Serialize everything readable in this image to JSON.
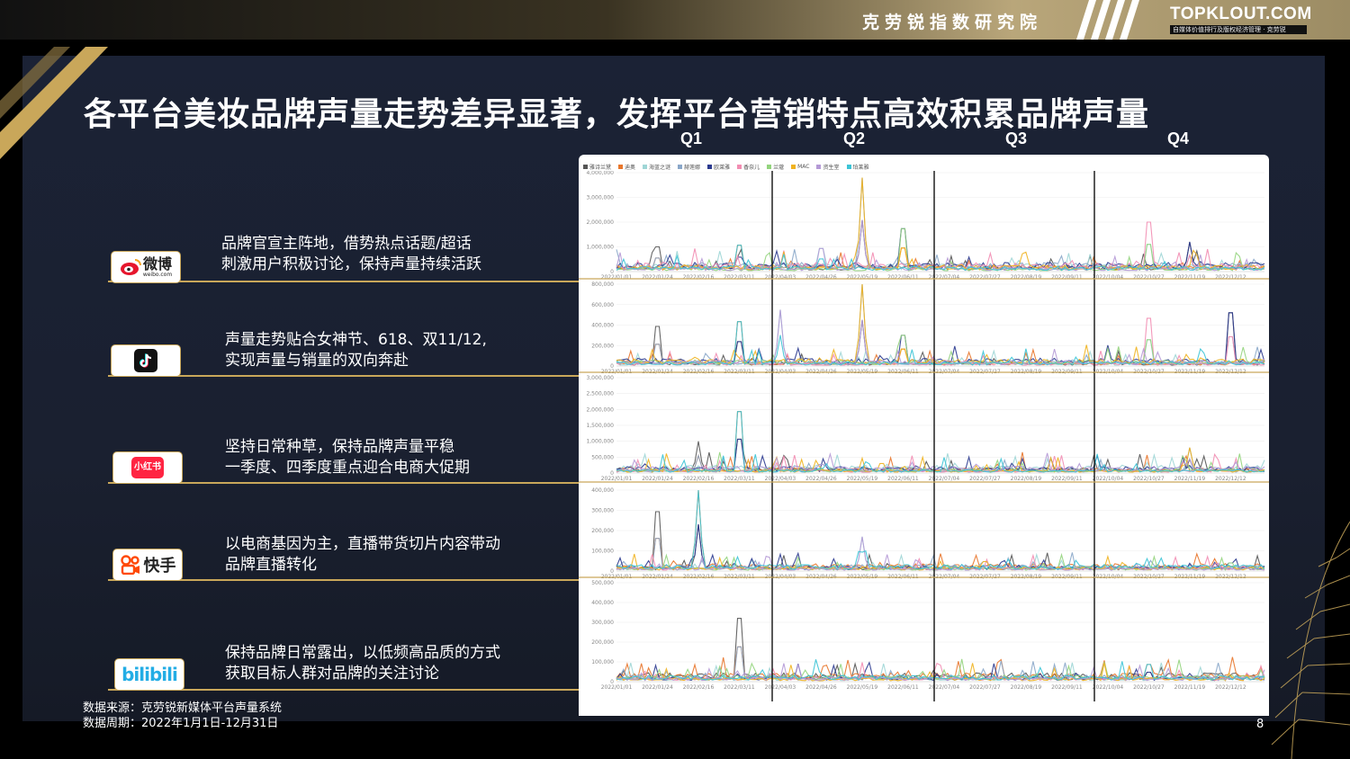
{
  "header": {
    "org_name": "克劳锐指数研究院",
    "logo_main": "TOPKLOUT.COM",
    "logo_sub": "自媒体价值排行及版权经济管理 · 克劳锐"
  },
  "title": "各平台美妆品牌声量走势差异显著，发挥平台营销特点高效积累品牌声量",
  "quarters": [
    "Q1",
    "Q2",
    "Q3",
    "Q4"
  ],
  "legend": [
    "雅诗兰黛",
    "迪奥",
    "海蓝之谜",
    "赫莲娜",
    "欧莱雅",
    "香奈儿",
    "兰蔻",
    "MAC",
    "资生堂",
    "珀莱雅"
  ],
  "colors": {
    "series": [
      "#555555",
      "#e8762b",
      "#9fd6d6",
      "#8aa7c9",
      "#2b3a8f",
      "#f28db2",
      "#93d47d",
      "#f0b21f",
      "#b59ad6",
      "#3cc4d6"
    ],
    "gold": "#c9a75a",
    "panel": "#1b2235"
  },
  "platforms": [
    {
      "name": "微博",
      "logo_text": "微博",
      "logo_sub": "weibo.com",
      "icon": "weibo-icon",
      "desc_line1": "品牌官宣主阵地，借势热点话题/超话",
      "desc_line2": "刺激用户积极讨论，保持声量持续活跃"
    },
    {
      "name": "抖音",
      "icon": "douyin-icon",
      "desc_line1": "声量走势贴合女神节、618、双11/12,",
      "desc_line2": "实现声量与销量的双向奔赴"
    },
    {
      "name": "小红书",
      "logo_text": "小红书",
      "icon": "xiaohongshu-icon",
      "desc_line1": "坚持日常种草，保持品牌声量平稳",
      "desc_line2": "一季度、四季度重点迎合电商大促期"
    },
    {
      "name": "快手",
      "logo_text": "快手",
      "icon": "kuaishou-icon",
      "desc_line1": "以电商基因为主，直播带货切片内容带动",
      "desc_line2": "品牌直播转化"
    },
    {
      "name": "哔哩哔哩",
      "logo_text": "bilibili",
      "icon": "bilibili-icon",
      "desc_line1": "保持品牌日常露出，以低频高品质的方式",
      "desc_line2": "获取目标人群对品牌的关注讨论"
    }
  ],
  "footer": {
    "source": "数据来源：克劳锐新媒体平台声量系统",
    "period": "数据周期：2022年1月1日-12月31日"
  },
  "page_number": "8",
  "chart_data": [
    {
      "type": "line",
      "platform": "微博",
      "ylim": [
        0,
        4000000
      ],
      "yticks": [
        "0",
        "1,000,000",
        "2,000,000",
        "3,000,000",
        "4,000,000"
      ],
      "x": [
        "2022/01/01",
        "2022/01/24",
        "2022/02/16",
        "2022/03/11",
        "2022/04/03",
        "2022/04/26",
        "2022/05/19",
        "2022/06/11",
        "2022/07/04",
        "2022/07/27",
        "2022/08/19",
        "2022/09/11",
        "2022/10/04",
        "2022/10/27",
        "2022/11/19",
        "2022/12/12"
      ],
      "peaks": [
        {
          "x": "2022/01/24",
          "value": 1500000
        },
        {
          "x": "2022/03/11",
          "value": 1600000
        },
        {
          "x": "2022/04/26",
          "value": 1400000
        },
        {
          "x": "2022/05/19",
          "value": 3800000
        },
        {
          "x": "2022/06/11",
          "value": 2600000
        },
        {
          "x": "2022/10/27",
          "value": 3000000
        },
        {
          "x": "2022/11/19",
          "value": 1200000
        }
      ]
    },
    {
      "type": "line",
      "platform": "抖音",
      "ylim": [
        0,
        800000
      ],
      "yticks": [
        "0",
        "200,000",
        "400,000",
        "600,000",
        "800,000"
      ],
      "x": [
        "2022/01/01",
        "2022/01/24",
        "2022/02/16",
        "2022/03/11",
        "2022/04/03",
        "2022/04/26",
        "2022/05/19",
        "2022/06/11",
        "2022/07/04",
        "2022/07/27",
        "2022/08/19",
        "2022/09/11",
        "2022/10/04",
        "2022/10/27",
        "2022/11/19",
        "2022/12/12"
      ],
      "peaks": [
        {
          "x": "2022/01/24",
          "value": 580000
        },
        {
          "x": "2022/03/11",
          "value": 650000
        },
        {
          "x": "2022/04/03",
          "value": 550000
        },
        {
          "x": "2022/05/19",
          "value": 820000
        },
        {
          "x": "2022/06/11",
          "value": 450000
        },
        {
          "x": "2022/10/27",
          "value": 700000
        },
        {
          "x": "2022/12/12",
          "value": 780000
        }
      ]
    },
    {
      "type": "line",
      "platform": "小红书",
      "ylim": [
        0,
        3000000
      ],
      "yticks": [
        "0",
        "500,000",
        "1,000,000",
        "1,500,000",
        "2,000,000",
        "2,500,000",
        "3,000,000"
      ],
      "x": [
        "2022/01/01",
        "2022/01/24",
        "2022/02/16",
        "2022/03/11",
        "2022/04/03",
        "2022/04/26",
        "2022/05/19",
        "2022/06/11",
        "2022/07/04",
        "2022/07/27",
        "2022/08/19",
        "2022/09/11",
        "2022/10/04",
        "2022/10/27",
        "2022/11/19",
        "2022/12/12"
      ],
      "peaks": [
        {
          "x": "2022/02/16",
          "value": 1000000
        },
        {
          "x": "2022/03/11",
          "value": 2900000
        },
        {
          "x": "2022/04/26",
          "value": 400000
        },
        {
          "x": "2022/11/19",
          "value": 800000
        }
      ]
    },
    {
      "type": "line",
      "platform": "快手",
      "ylim": [
        0,
        400000
      ],
      "yticks": [
        "0",
        "100,000",
        "200,000",
        "300,000",
        "400,000"
      ],
      "x": [
        "2022/01/01",
        "2022/01/24",
        "2022/02/16",
        "2022/03/11",
        "2022/04/03",
        "2022/04/26",
        "2022/05/19",
        "2022/06/11",
        "2022/07/04",
        "2022/07/27",
        "2022/08/19",
        "2022/09/11",
        "2022/10/04",
        "2022/10/27",
        "2022/11/19",
        "2022/12/12"
      ],
      "peaks": [
        {
          "x": "2022/01/24",
          "value": 440000
        },
        {
          "x": "2022/02/16",
          "value": 420000
        },
        {
          "x": "2022/05/19",
          "value": 170000
        },
        {
          "x": "2022/07/27",
          "value": 70000
        },
        {
          "x": "2022/12/12",
          "value": 60000
        }
      ]
    },
    {
      "type": "line",
      "platform": "哔哩哔哩",
      "ylim": [
        0,
        500000
      ],
      "yticks": [
        "0",
        "100,000",
        "200,000",
        "300,000",
        "400,000",
        "500,000"
      ],
      "x": [
        "2022/01/01",
        "2022/01/24",
        "2022/02/16",
        "2022/03/11",
        "2022/04/03",
        "2022/04/26",
        "2022/05/19",
        "2022/06/11",
        "2022/07/04",
        "2022/07/27",
        "2022/08/19",
        "2022/09/11",
        "2022/10/04",
        "2022/10/27",
        "2022/11/19",
        "2022/12/12"
      ],
      "peaks": [
        {
          "x": "2022/03/11",
          "value": 480000
        },
        {
          "x": "2022/10/27",
          "value": 130000
        }
      ]
    }
  ]
}
